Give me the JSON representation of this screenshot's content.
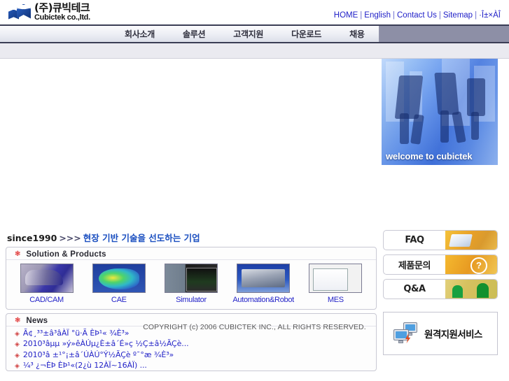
{
  "header": {
    "logo": {
      "korean": "(주)큐빅테크",
      "english": "Cubictek co.,ltd.",
      "icon": "cube-logo-icon"
    },
    "top_links": [
      {
        "label": "HOME"
      },
      {
        "label": "English"
      },
      {
        "label": "Contact Us"
      },
      {
        "label": "Sitemap"
      },
      {
        "label": "·Î±×ÀÎ"
      }
    ],
    "top_link_separator": "|"
  },
  "nav": {
    "items": [
      {
        "label": "회사소개"
      },
      {
        "label": "솔루션"
      },
      {
        "label": "고객지원"
      },
      {
        "label": "다운로드"
      },
      {
        "label": "채용"
      }
    ]
  },
  "banner": {
    "caption": "welcome to cubictek",
    "alt": "blue-tinted photo of business people walking"
  },
  "tagline": {
    "since": "since1990",
    "arrows": ">>>",
    "korean": "현장 기반 기술을 선도하는 기업"
  },
  "solution_box": {
    "bullet": "❃",
    "title": "Solution & Products",
    "products": [
      {
        "label": "CAD/CAM",
        "thumb": "th-cad",
        "icon": "car-model-icon"
      },
      {
        "label": "CAE",
        "thumb": "th-cae",
        "icon": "fea-mesh-icon"
      },
      {
        "label": "Simulator",
        "thumb": "th-sim",
        "icon": "cnc-simulator-icon"
      },
      {
        "label": "Automation&Robot",
        "thumb": "th-auto",
        "icon": "production-line-icon"
      },
      {
        "label": "MES",
        "thumb": "th-mes",
        "icon": "chart-dashboard-icon"
      }
    ]
  },
  "news_box": {
    "bullet": "❃",
    "title": "News",
    "item_bullet": "◈",
    "items": [
      {
        "text": "Ã¢¸³³±â³âÀÏ °ü·Ã ÈÞ¹« ¾È³»"
      },
      {
        "text": "2010³âµµ »ý»êÀÚµ¿È±â´É»ç ½Ç±â½ÃÇè..."
      },
      {
        "text": "2010³â ±¹°¡±â´ÚÀÚ°Ý½ÃÇè º¯°æ ¾È³»"
      },
      {
        "text": "¼³ ¿¬ÈÞ ÈÞ¹«(2¿ù 12ÀÏ~16ÀÏ) ..."
      }
    ]
  },
  "side_buttons": [
    {
      "label": "FAQ",
      "art": "art-faq",
      "icon": "folders-icon"
    },
    {
      "label": "제품문의",
      "art": "art-ask",
      "icon": "question-mark-icon"
    },
    {
      "label": "Q&A",
      "art": "art-qa",
      "icon": "two-people-icon"
    }
  ],
  "remote_support": {
    "label": "원격지원서비스",
    "icon": "two-monitors-lightning-icon"
  },
  "footer": {
    "copyright": "COPYRIGHT (c) 2006 CUBICTEK INC., ALL RIGHTS RESERVED."
  },
  "colors": {
    "link_blue": "#2424c8",
    "nav_border": "#3a3d55",
    "nav_bg": "#8d8fa6",
    "accent_red": "#e03030",
    "tagline_blue": "#1b4fc0"
  }
}
